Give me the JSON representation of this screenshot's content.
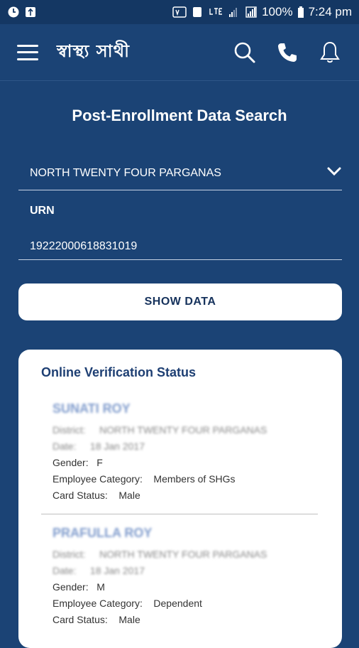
{
  "statusbar": {
    "left_icons": [
      "clock-icon",
      "usb-icon"
    ],
    "battery": "100%",
    "time": "7:24 pm"
  },
  "header": {
    "logo": "স্বাস্থ্য সাথী"
  },
  "page": {
    "title": "Post-Enrollment Data Search",
    "district": "NORTH TWENTY FOUR PARGANAS",
    "urn_label": "URN",
    "urn_value": "19222000618831019",
    "show_button": "SHOW DATA"
  },
  "card": {
    "title": "Online Verification Status",
    "records": [
      {
        "name": "SUNATI ROY",
        "district_label": "District:",
        "district": "NORTH TWENTY FOUR PARGANAS",
        "date_label": "Date:",
        "date": "18 Jan 2017",
        "gender_label": "Gender:",
        "gender": "F",
        "category_label": "Employee Category:",
        "category": "Members of SHGs",
        "card_label": "Card Status:",
        "card": "Male"
      },
      {
        "name": "PRAFULLA ROY",
        "district_label": "District:",
        "district": "NORTH TWENTY FOUR PARGANAS",
        "date_label": "Date:",
        "date": "18 Jan 2017",
        "gender_label": "Gender:",
        "gender": "M",
        "category_label": "Employee Category:",
        "category": "Dependent",
        "card_label": "Card Status:",
        "card": "Male"
      }
    ]
  }
}
